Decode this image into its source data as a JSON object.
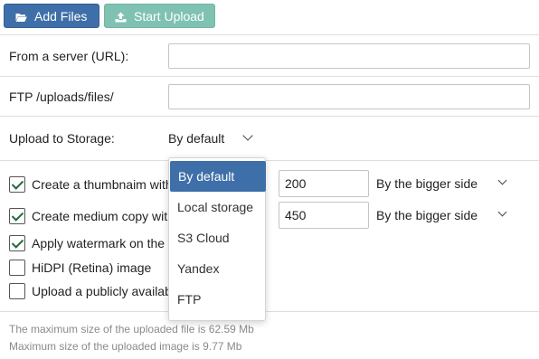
{
  "toolbar": {
    "add_files_label": "Add Files",
    "start_upload_label": "Start Upload",
    "add_icon": "folder-open-icon",
    "upload_icon": "upload-icon"
  },
  "form": {
    "server_url_label": "From a server (URL):",
    "server_url_value": "",
    "ftp_label": "FTP /uploads/files/",
    "ftp_value": "",
    "storage_label": "Upload to Storage:",
    "storage_selected": "By default"
  },
  "storage_options": [
    "By default",
    "Local storage",
    "S3 Cloud",
    "Yandex",
    "FTP"
  ],
  "options": {
    "thumbnail": {
      "label": "Create a thumbnaim with",
      "checked": true,
      "size": "200",
      "side": "By the bigger side"
    },
    "medium": {
      "label": "Create medium copy with",
      "checked": true,
      "size": "450",
      "side": "By the bigger side"
    },
    "watermark": {
      "label": "Apply watermark on the",
      "checked": true
    },
    "hidpi": {
      "label": "HiDPI (Retina) image",
      "checked": false
    },
    "public": {
      "label": "Upload a publicly availab",
      "checked": false
    }
  },
  "info": {
    "max_file": "The maximum size of the uploaded file is 62.59 Mb",
    "max_image": "Maximum size of the uploaded image is 9.77 Mb"
  },
  "colors": {
    "primary": "#3f6fa8",
    "secondary": "#7fc2b2",
    "check": "#1e6b3a"
  }
}
